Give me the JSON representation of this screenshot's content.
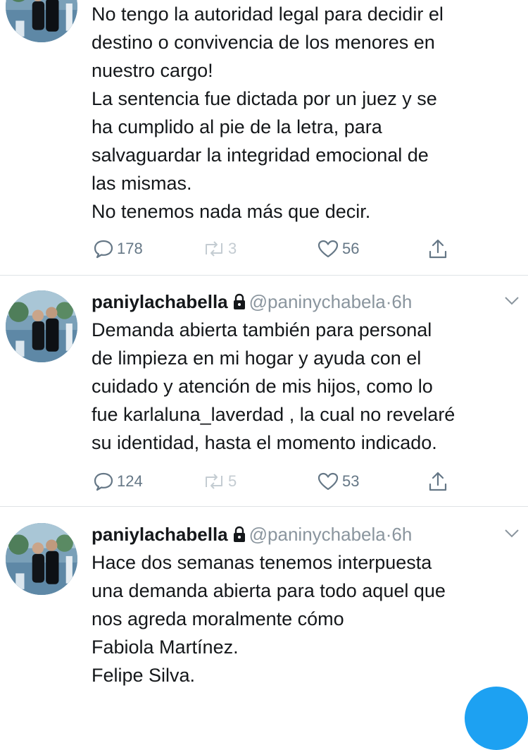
{
  "tweets": [
    {
      "lines": [
        "No tengo la autoridad legal para decidir el",
        "destino o convivencia de los menores en",
        "nuestro cargo!",
        "La sentencia fue dictada por un juez  y se",
        "ha cumplido al pie de la letra, para",
        "salvaguardar la integridad emocional de",
        "las mismas.",
        "No tenemos nada más que decir."
      ],
      "replies": "178",
      "retweets": "3",
      "likes": "56"
    },
    {
      "name": "paniylachabella",
      "handle": "@paninychabela",
      "dot": "·",
      "time": "6h",
      "lines": [
        "Demanda abierta también para personal",
        "de limpieza en mi hogar y ayuda con el",
        "cuidado y atención de mis hijos, como lo",
        "fue karlaluna_laverdad , la cual no revelaré",
        "su identidad, hasta el momento indicado."
      ],
      "replies": "124",
      "retweets": "5",
      "likes": "53"
    },
    {
      "name": "paniylachabella",
      "handle": "@paninychabela",
      "dot": "·",
      "time": "6h",
      "lines": [
        "Hace dos semanas tenemos interpuesta",
        "una demanda abierta para todo aquel que",
        "nos agreda moralmente cómo",
        "Fabiola Martínez.",
        "Felipe Silva."
      ]
    }
  ],
  "icons": {
    "reply": "comment-bubble-icon",
    "retweet": "retweet-icon",
    "like": "heart-icon",
    "share": "share-icon",
    "lock": "lock-icon",
    "chevron": "chevron-down-icon"
  },
  "colors": {
    "text": "#14171a",
    "muted": "#8a959e",
    "divider": "#dfe3e6",
    "accent": "#1da1f2"
  }
}
